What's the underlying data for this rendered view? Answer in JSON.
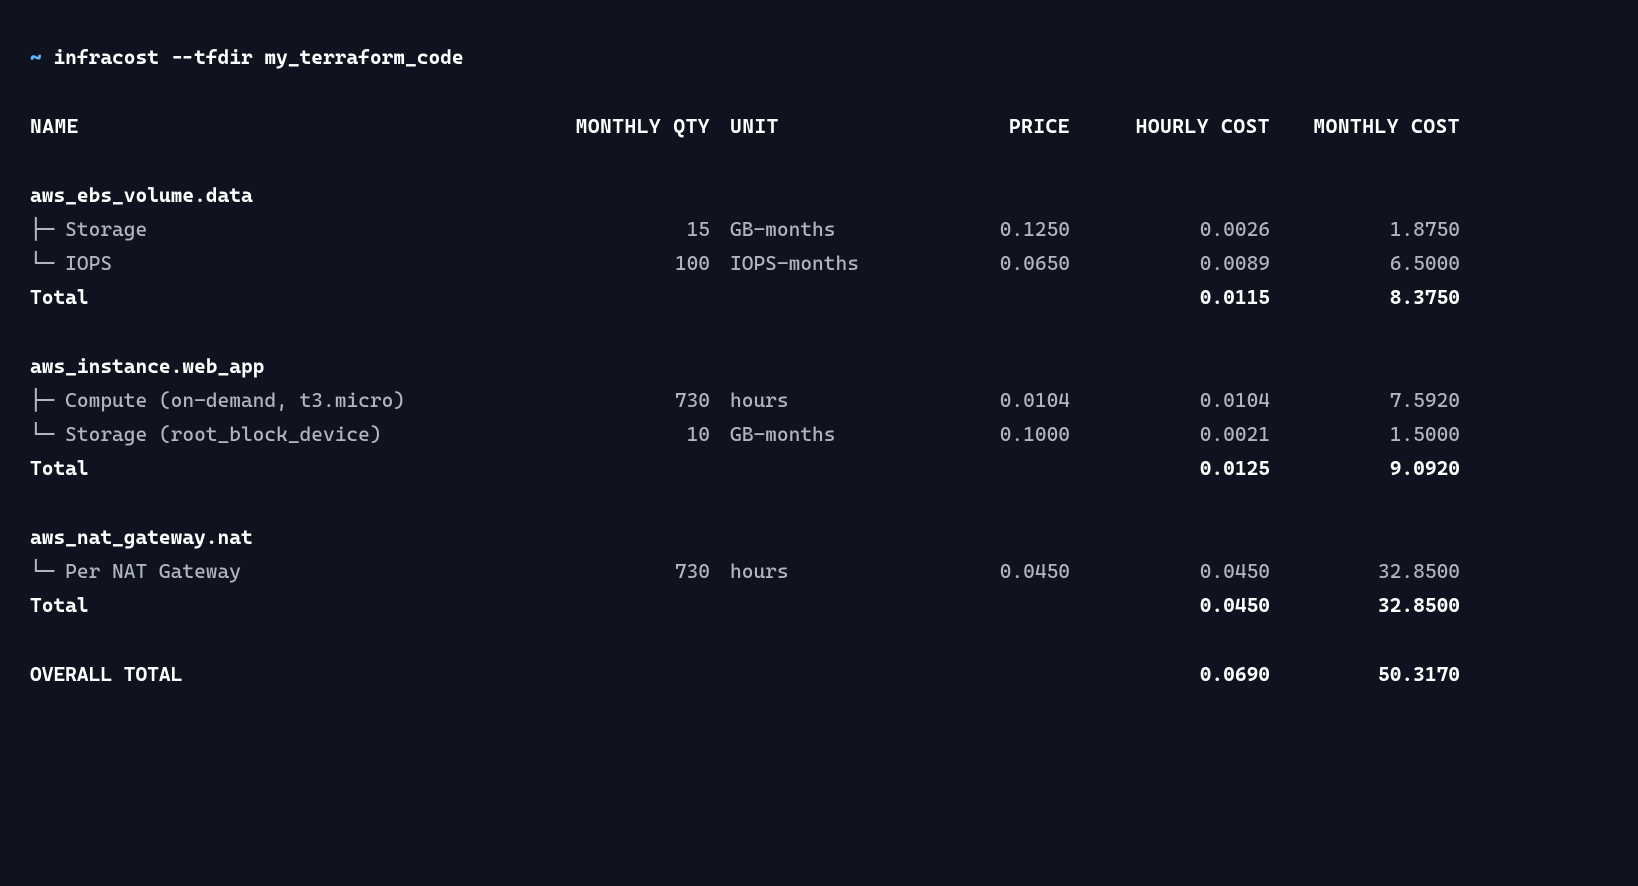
{
  "prompt": {
    "symbol": "~",
    "command": "infracost --tfdir my_terraform_code"
  },
  "headers": {
    "name": "NAME",
    "qty": "MONTHLY QTY",
    "unit": "UNIT",
    "price": "PRICE",
    "hourly": "HOURLY COST",
    "monthly": "MONTHLY COST"
  },
  "groups": [
    {
      "title": "aws_ebs_volume.data",
      "items": [
        {
          "prefix": "├─ ",
          "name": "Storage",
          "qty": "15",
          "unit": "GB-months",
          "price": "0.1250",
          "hourly": "0.0026",
          "monthly": "1.8750"
        },
        {
          "prefix": "└─ ",
          "name": "IOPS",
          "qty": "100",
          "unit": "IOPS-months",
          "price": "0.0650",
          "hourly": "0.0089",
          "monthly": "6.5000"
        }
      ],
      "total_label": "Total",
      "total_hourly": "0.0115",
      "total_monthly": "8.3750"
    },
    {
      "title": "aws_instance.web_app",
      "items": [
        {
          "prefix": "├─ ",
          "name": "Compute (on-demand, t3.micro)",
          "qty": "730",
          "unit": "hours",
          "price": "0.0104",
          "hourly": "0.0104",
          "monthly": "7.5920"
        },
        {
          "prefix": "└─ ",
          "name": "Storage (root_block_device)",
          "qty": "10",
          "unit": "GB-months",
          "price": "0.1000",
          "hourly": "0.0021",
          "monthly": "1.5000"
        }
      ],
      "total_label": "Total",
      "total_hourly": "0.0125",
      "total_monthly": "9.0920"
    },
    {
      "title": "aws_nat_gateway.nat",
      "items": [
        {
          "prefix": "└─ ",
          "name": "Per NAT Gateway",
          "qty": "730",
          "unit": "hours",
          "price": "0.0450",
          "hourly": "0.0450",
          "monthly": "32.8500"
        }
      ],
      "total_label": "Total",
      "total_hourly": "0.0450",
      "total_monthly": "32.8500"
    }
  ],
  "overall": {
    "label": "OVERALL TOTAL",
    "hourly": "0.0690",
    "monthly": "50.3170"
  }
}
